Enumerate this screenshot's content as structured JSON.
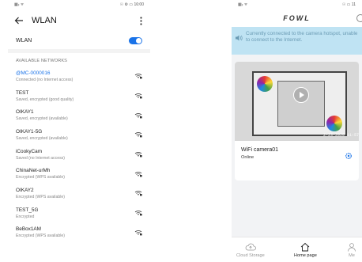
{
  "wlan_screen": {
    "status_bar": {
      "left": "▦ᵢₗ ᯤ",
      "right": "☉ ⚙ ▭ 16:00"
    },
    "header": {
      "title": "WLAN"
    },
    "toggle": {
      "label": "WLAN",
      "on": true
    },
    "section_title": "AVAILABLE NETWORKS",
    "networks": [
      {
        "name": "@MC-0000016",
        "status": "Connected (no Internet access)",
        "active": true
      },
      {
        "name": "TEST",
        "status": "Saved, encrypted (good quality)"
      },
      {
        "name": "OIKAY1",
        "status": "Saved, encrypted (available)"
      },
      {
        "name": "OIKAY1-5G",
        "status": "Saved, encrypted (available)"
      },
      {
        "name": "iCookyCam",
        "status": "Saved (no Internet access)"
      },
      {
        "name": "ChinaNet-urMh",
        "status": "Encrypted (WPS available)"
      },
      {
        "name": "OIKAY2",
        "status": "Encrypted (WPS available)"
      },
      {
        "name": "TEST_5G",
        "status": "Encrypted"
      },
      {
        "name": "BeBox1AM",
        "status": "Encrypted (WPS available)"
      }
    ]
  },
  "app_screen": {
    "status_bar": {
      "left": "▦ᵢₗ ᯤ",
      "right": "☉ ▭ 11"
    },
    "logo": "FOWL",
    "notice": "Currently connected to the camera hotspot, unable to connect to the Internet.",
    "camera": {
      "name": "WiFi camera01",
      "status": "Online",
      "timestamp": "2-23-2020 11:57"
    },
    "nav": [
      {
        "label": "Cloud Storage",
        "icon": "cloud-upload-icon"
      },
      {
        "label": "Home page",
        "icon": "home-icon",
        "active": true
      },
      {
        "label": "Me",
        "icon": "person-icon"
      }
    ],
    "colors": {
      "notice_bg": "#bfe3f3",
      "toggle": "#1a73e8",
      "link": "#1a73e8"
    }
  }
}
